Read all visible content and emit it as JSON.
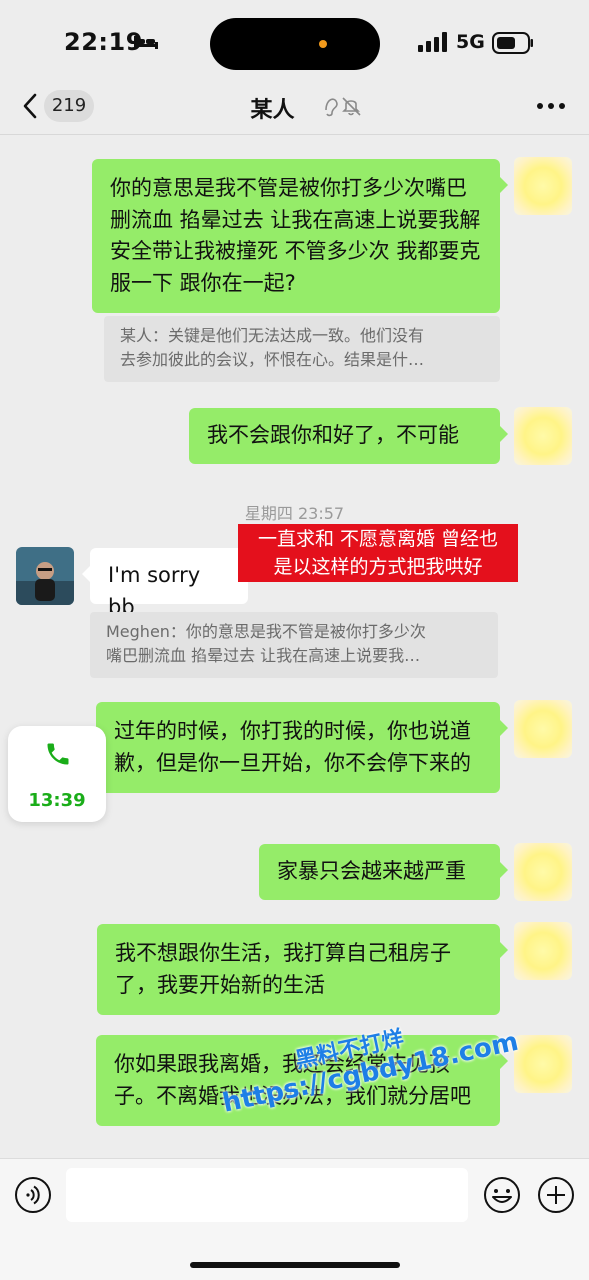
{
  "status_bar": {
    "time": "22:19",
    "network": "5G"
  },
  "nav": {
    "back_count": "219",
    "title": "某人"
  },
  "messages": [
    {
      "side": "right",
      "text": "你的意思是我不管是被你打多少次嘴巴删流血 掐晕过去 让我在高速上说要我解安全带让我被撞死 不管多少次 我都要克服一下 跟你在一起?"
    },
    {
      "type": "quote",
      "text_line1": "某人：关键是他们无法达成一致。他们没有",
      "text_line2": "去参加彼此的会议，怀恨在心。结果是什…"
    },
    {
      "side": "right",
      "text": "我不会跟你和好了，不可能"
    },
    {
      "type": "time",
      "text": "星期四 23:57"
    },
    {
      "side": "left",
      "text": "I'm sorry bb"
    },
    {
      "type": "quote",
      "text_line1": "Meghen：你的意思是我不管是被你打多少次",
      "text_line2": "嘴巴删流血 掐晕过去 让我在高速上说要我…"
    },
    {
      "side": "right",
      "text": "过年的时候，你打我的时候，你也说道歉，但是你一旦开始，你不会停下来的"
    },
    {
      "side": "right",
      "text": "家暴只会越来越严重"
    },
    {
      "side": "right",
      "text": "我不想跟你生活，我打算自己租房子了，我要开始新的生活"
    },
    {
      "side": "right",
      "text": "你如果跟我离婚，我还会经常去见孩子。不离婚我也没办法，我们就分居吧"
    }
  ],
  "annotation_banner": {
    "line1": "一直求和 不愿意离婚 曾经也",
    "line2": "是以这样的方式把我哄好"
  },
  "call_card": {
    "time": "13:39"
  },
  "watermark": {
    "line1": "黑料不打烊",
    "line2": "https://cgbdy18.com"
  },
  "input": {
    "placeholder": ""
  },
  "colors": {
    "bubble_green": "#95ec69",
    "background": "#ededed",
    "banner_red": "#e4101c",
    "call_green": "#1aad19"
  }
}
